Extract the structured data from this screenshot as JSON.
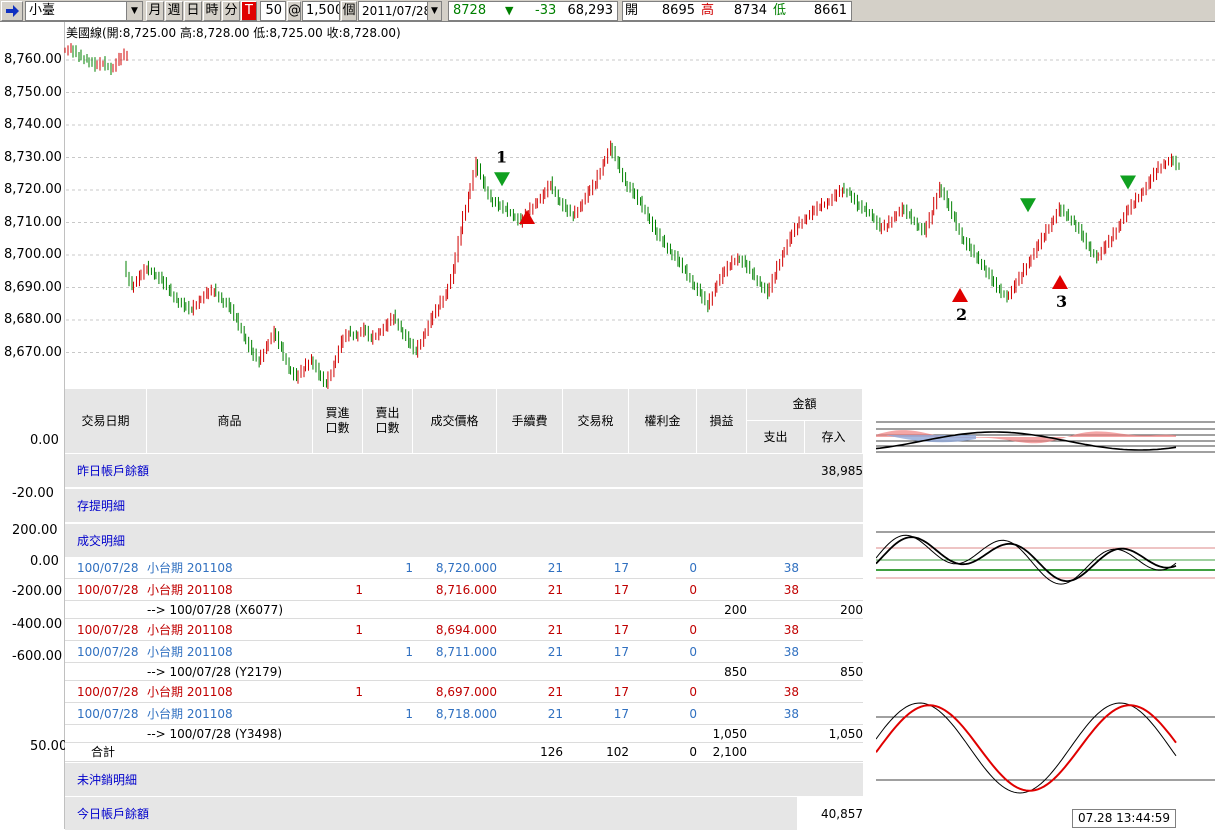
{
  "toolbar": {
    "product": "小臺",
    "period_buttons": [
      "月",
      "週",
      "日",
      "時",
      "分"
    ],
    "interval_flag": "T",
    "bar_count": "50",
    "at_label": "@",
    "unit_value": "1,500",
    "unit_label": "個",
    "date": "2011/07/28",
    "last_price": "8728",
    "change": "-33",
    "volume": "68,293",
    "open_label": "開",
    "open_value": "8695",
    "high_label": "高",
    "high_value": "8734",
    "low_label": "低",
    "low_value": "8661"
  },
  "legend": "美國線(開:8,725.00 高:8,728.00 低:8,725.00 收:8,728.00)",
  "colors": {
    "up_bar": "#d00000",
    "down_bar": "#008000",
    "grid": "#c8c8c8",
    "buy_marker": "#e00000",
    "sell_marker": "#10a020"
  },
  "y_axis": {
    "price_ticks": [
      "8,760.00",
      "8,750.00",
      "8,740.00",
      "8,730.00",
      "8,720.00",
      "8,710.00",
      "8,700.00",
      "8,690.00",
      "8,680.00",
      "8,670.00"
    ],
    "ind1_ticks": [
      "0.00",
      "-20.00"
    ],
    "ind2_ticks": [
      "200.00",
      "0.00",
      "-200.00",
      "-400.00",
      "-600.00"
    ],
    "ind3_ticks": [
      "50.00"
    ]
  },
  "chart_data": {
    "type": "ohlc",
    "title": "美國線(開:8,725.00 高:8,728.00 低:8,725.00 收:8,728.00)",
    "ylim": [
      8660,
      8766
    ],
    "close_series": [
      8763,
      8761,
      8760,
      8758,
      8759,
      8757,
      8760,
      8762,
      8690,
      8693,
      8696,
      8694,
      8692,
      8689,
      8686,
      8684,
      8683,
      8686,
      8688,
      8689,
      8686,
      8684,
      8680,
      8675,
      8670,
      8667,
      8672,
      8676,
      8671,
      8665,
      8662,
      8665,
      8668,
      8663,
      8660,
      8666,
      8673,
      8676,
      8675,
      8677,
      8674,
      8676,
      8678,
      8681,
      8677,
      8673,
      8670,
      8675,
      8680,
      8684,
      8688,
      8695,
      8708,
      8718,
      8728,
      8722,
      8717,
      8715,
      8714,
      8712,
      8710,
      8713,
      8716,
      8718,
      8722,
      8717,
      8714,
      8712,
      8715,
      8719,
      8722,
      8728,
      8733,
      8728,
      8722,
      8719,
      8716,
      8712,
      8707,
      8704,
      8701,
      8698,
      8695,
      8691,
      8688,
      8684,
      8690,
      8694,
      8697,
      8699,
      8697,
      8694,
      8691,
      8688,
      8694,
      8700,
      8705,
      8709,
      8711,
      8713,
      8715,
      8716,
      8718,
      8720,
      8719,
      8715,
      8714,
      8712,
      8708,
      8709,
      8712,
      8714,
      8712,
      8709,
      8707,
      8713,
      8721,
      8716,
      8711,
      8705,
      8702,
      8699,
      8696,
      8692,
      8689,
      8687,
      8690,
      8694,
      8698,
      8702,
      8706,
      8710,
      8714,
      8712,
      8710,
      8706,
      8702,
      8699,
      8702,
      8705,
      8709,
      8713,
      8716,
      8719,
      8722,
      8726,
      8728,
      8729,
      8727
    ],
    "markers": [
      {
        "type": "sell",
        "label": "1",
        "price": 8723
      },
      {
        "type": "buy",
        "price": 8712
      },
      {
        "type": "buy",
        "label": "2",
        "price": 8688
      },
      {
        "type": "sell",
        "price": 8715
      },
      {
        "type": "buy",
        "label": "3",
        "price": 8692
      },
      {
        "type": "sell",
        "price": 8722
      }
    ]
  },
  "table": {
    "headers": {
      "date": "交易日期",
      "product": "商品",
      "buy_qty": [
        "買進",
        "口數"
      ],
      "sell_qty": [
        "賣出",
        "口數"
      ],
      "price": "成交價格",
      "fee": "手續費",
      "tax": "交易稅",
      "premium": "權利金",
      "pnl": "損益",
      "amount": "金額",
      "out": "支出",
      "in": "存入"
    },
    "prev_balance_label": "昨日帳戶餘額",
    "prev_balance_value": "38,985",
    "deposit_section": "存提明細",
    "trade_section": "成交明細",
    "trades": [
      {
        "kind": "trade",
        "side": "sell",
        "date": "100/07/28",
        "product": "小台期 201108",
        "buy": "",
        "sell": "1",
        "price": "8,720.000",
        "fee": "21",
        "tax": "17",
        "premium": "0",
        "out": "38"
      },
      {
        "kind": "trade",
        "side": "buy",
        "date": "100/07/28",
        "product": "小台期 201108",
        "buy": "1",
        "sell": "",
        "price": "8,716.000",
        "fee": "21",
        "tax": "17",
        "premium": "0",
        "out": "38"
      },
      {
        "kind": "ref",
        "text": "--> 100/07/28 (X6077)",
        "pnl": "200",
        "in": "200"
      },
      {
        "kind": "trade",
        "side": "buy",
        "date": "100/07/28",
        "product": "小台期 201108",
        "buy": "1",
        "sell": "",
        "price": "8,694.000",
        "fee": "21",
        "tax": "17",
        "premium": "0",
        "out": "38"
      },
      {
        "kind": "trade",
        "side": "sell",
        "date": "100/07/28",
        "product": "小台期 201108",
        "buy": "",
        "sell": "1",
        "price": "8,711.000",
        "fee": "21",
        "tax": "17",
        "premium": "0",
        "out": "38"
      },
      {
        "kind": "ref",
        "text": "--> 100/07/28 (Y2179)",
        "pnl": "850",
        "in": "850"
      },
      {
        "kind": "trade",
        "side": "buy",
        "date": "100/07/28",
        "product": "小台期 201108",
        "buy": "1",
        "sell": "",
        "price": "8,697.000",
        "fee": "21",
        "tax": "17",
        "premium": "0",
        "out": "38"
      },
      {
        "kind": "trade",
        "side": "sell",
        "date": "100/07/28",
        "product": "小台期 201108",
        "buy": "",
        "sell": "1",
        "price": "8,718.000",
        "fee": "21",
        "tax": "17",
        "premium": "0",
        "out": "38"
      },
      {
        "kind": "ref",
        "text": "--> 100/07/28 (Y3498)",
        "pnl": "1,050",
        "in": "1,050"
      }
    ],
    "total": {
      "label": "合計",
      "fee": "126",
      "tax": "102",
      "premium": "0",
      "pnl": "2,100"
    },
    "open_section": "未沖銷明細",
    "today_balance_label": "今日帳戶餘額",
    "today_balance_value": "40,857"
  },
  "clock": "07.28 13:44:59"
}
